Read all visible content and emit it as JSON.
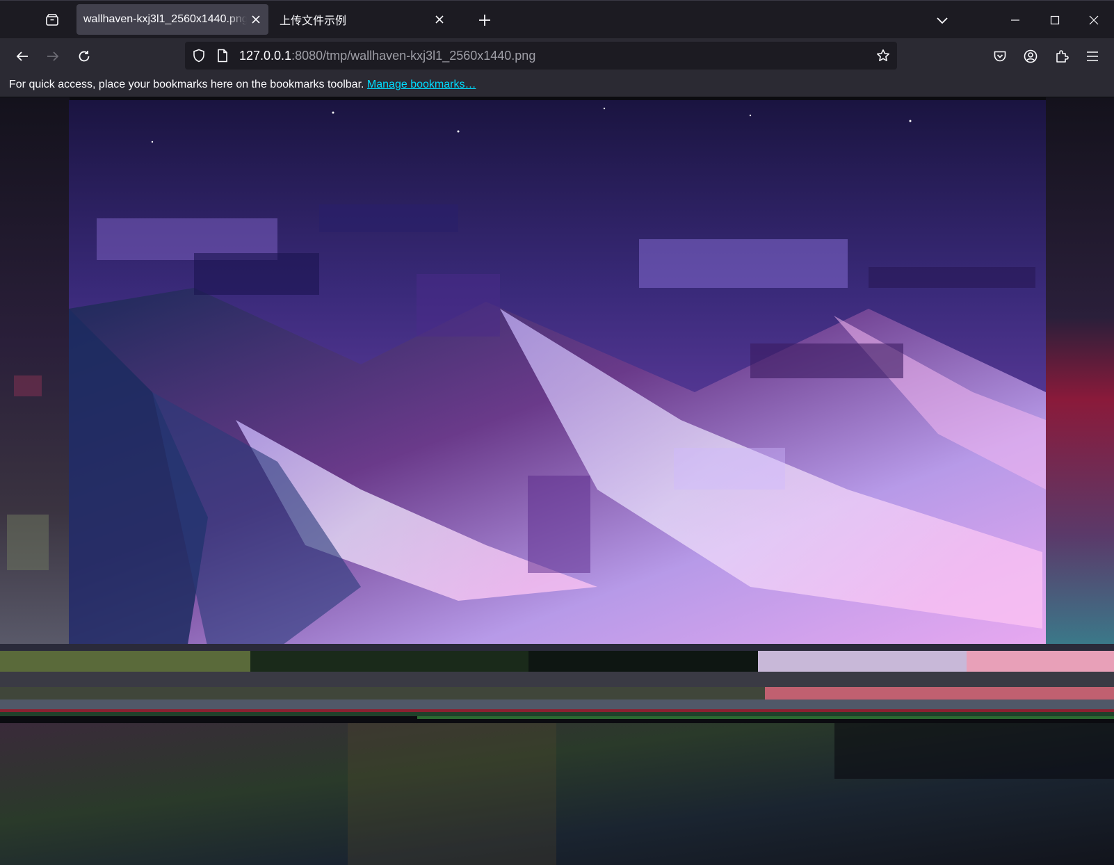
{
  "window": {
    "tabs": [
      {
        "title": "wallhaven-kxj3l1_2560x1440.png",
        "active": true
      },
      {
        "title": "上传文件示例",
        "active": false
      }
    ],
    "controls": [
      "list-all-tabs",
      "minimize",
      "maximize",
      "close"
    ]
  },
  "navbar": {
    "url_host": "127.0.0.1",
    "url_rest": ":8080/tmp/wallhaven-kxj3l1_2560x1440.png"
  },
  "bookmarks_bar": {
    "message": "For quick access, place your bookmarks here on the bookmarks toolbar.",
    "link": "Manage bookmarks…"
  },
  "content": {
    "image_name": "wallhaven-kxj3l1_2560x1440.png"
  },
  "colors": {
    "toolbar": "#2b2a33",
    "tabstrip": "#1c1b22",
    "active_tab": "#42414d",
    "link": "#00ddff"
  }
}
